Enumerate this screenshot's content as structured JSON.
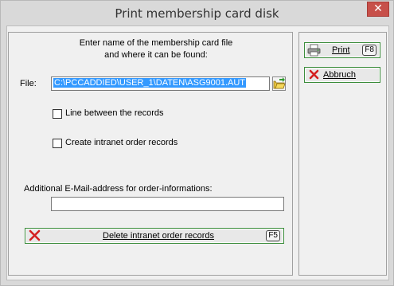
{
  "window": {
    "title": "Print membership card disk",
    "close_glyph": "✕"
  },
  "intro": {
    "line1": "Enter name of the membership card file",
    "line2": "and where it can be found:"
  },
  "file": {
    "label": "File:",
    "value": "C:\\PCCADDIED\\USER_1\\DATEN\\ASG9001.AUT",
    "browse_icon": "folder-open-icon"
  },
  "options": {
    "line_between": {
      "label": "Line between the records",
      "checked": false
    },
    "create_intranet": {
      "label": "Create intranet order records",
      "checked": false
    }
  },
  "email": {
    "label": "Additional E-Mail-address for order-informations:",
    "value": ""
  },
  "delete_button": {
    "label": "Delete intranet order records",
    "key": "F5",
    "icon": "red-x-icon"
  },
  "print_button": {
    "label": "Print",
    "key": "F8",
    "icon": "printer-icon"
  },
  "cancel_button": {
    "label": "Abbruch",
    "icon": "red-x-icon"
  },
  "colors": {
    "selection": "#3399ff",
    "button_border": "#3b8d3b",
    "close": "#c7504a"
  }
}
